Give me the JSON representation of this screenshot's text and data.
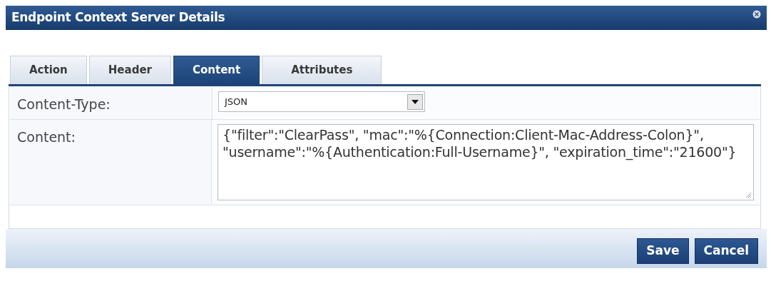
{
  "dialog": {
    "title": "Endpoint Context Server Details"
  },
  "tabs": [
    {
      "label": "Action",
      "selected": false
    },
    {
      "label": "Header",
      "selected": false
    },
    {
      "label": "Content",
      "selected": true
    },
    {
      "label": "Attributes",
      "selected": false
    }
  ],
  "fields": [
    {
      "kind": "select",
      "label": "Content-Type:",
      "value": "JSON"
    },
    {
      "kind": "textarea",
      "label": "Content:",
      "value": "{\"filter\":\"ClearPass\", \"mac\":\"%{Connection:Client-Mac-Address-Colon}\", \"username\":\"%{Authentication:Full-Username}\", \"expiration_time\":\"21600\"}"
    }
  ],
  "buttons": [
    "Save",
    "Cancel"
  ]
}
